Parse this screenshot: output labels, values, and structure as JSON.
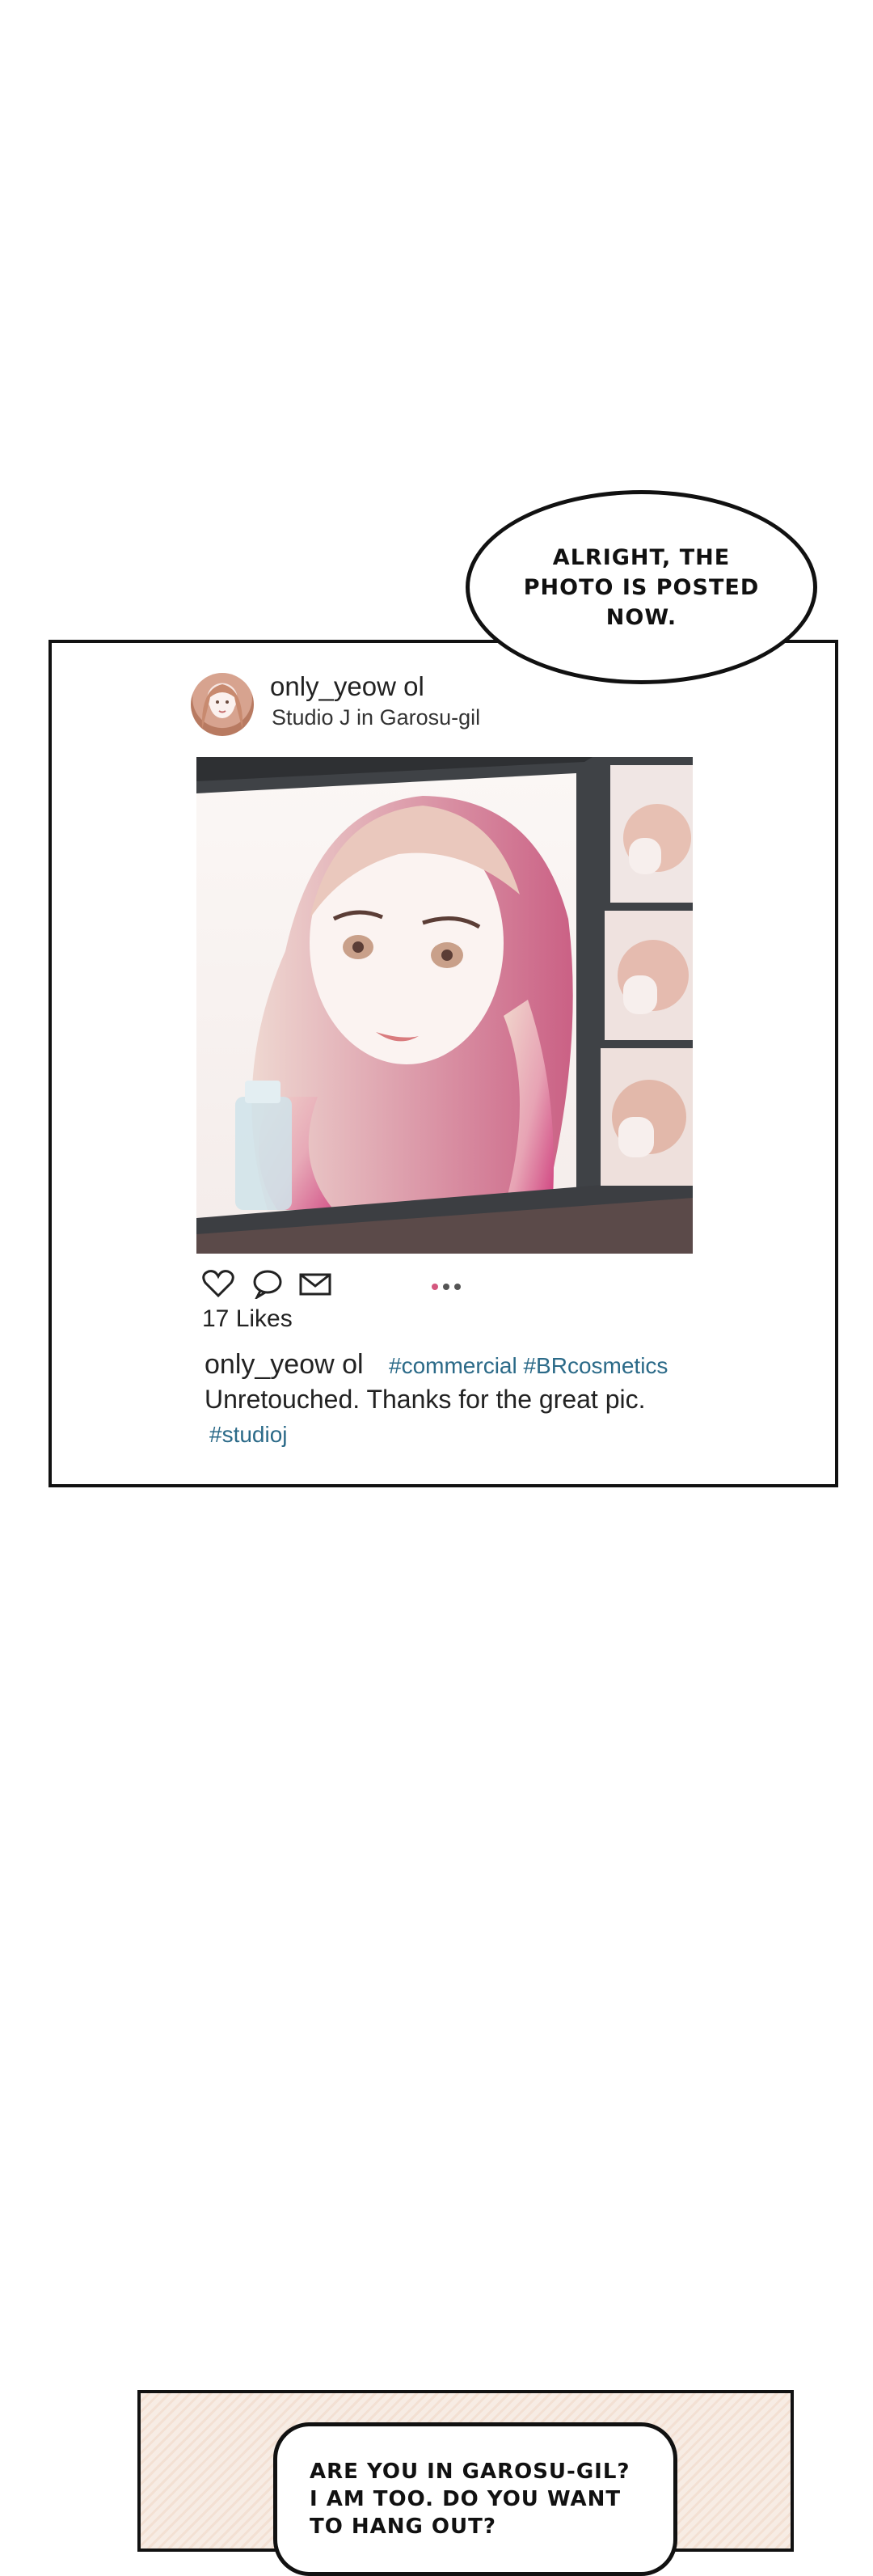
{
  "bubble_top": {
    "line1": "ALRIGHT, THE",
    "line2": "PHOTO IS POSTED",
    "line3": "NOW."
  },
  "post": {
    "username": "only_yeow  ol",
    "location": "Studio J in Garosu-gil",
    "likes": "17 Likes",
    "caption_user": "only_yeow  ol",
    "caption_tags": "#commercial #BRcosmetics",
    "caption_text": "Unretouched. Thanks for the great pic.",
    "caption_tag2": "#studioj",
    "icons": [
      "heart-icon",
      "comment-icon",
      "send-icon"
    ],
    "carousel": {
      "count": 3,
      "active": 1
    }
  },
  "bubble_bottom": {
    "line1": "ARE YOU IN GAROSU-GIL?",
    "line2": "I AM TOO. DO YOU WANT",
    "line3": "TO HANG OUT?"
  },
  "colors": {
    "hashtag": "#2b6a88",
    "active_dot": "#d4577e"
  }
}
